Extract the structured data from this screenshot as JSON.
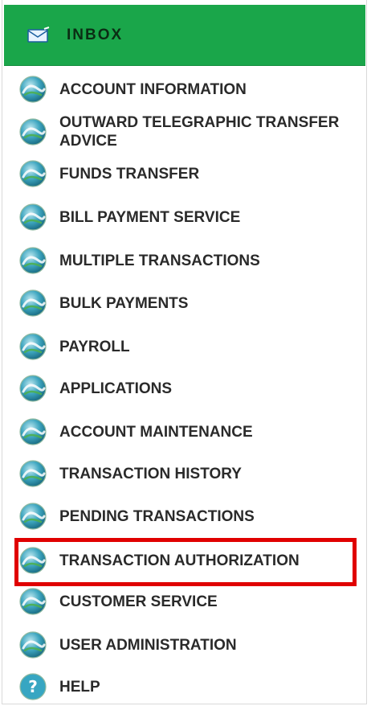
{
  "header": {
    "title": "INBOX",
    "icon": "envelope-icon",
    "background_color": "#1aa64a"
  },
  "menu": {
    "icon": "globe-icon",
    "highlight_color": "#e00000",
    "items": [
      {
        "label": "ACCOUNT INFORMATION"
      },
      {
        "label": "OUTWARD TELEGRAPHIC TRANSFER ADVICE"
      },
      {
        "label": "FUNDS TRANSFER"
      },
      {
        "label": "BILL PAYMENT SERVICE"
      },
      {
        "label": "MULTIPLE TRANSACTIONS"
      },
      {
        "label": "BULK PAYMENTS"
      },
      {
        "label": "PAYROLL"
      },
      {
        "label": "APPLICATIONS"
      },
      {
        "label": "ACCOUNT MAINTENANCE"
      },
      {
        "label": "TRANSACTION HISTORY"
      },
      {
        "label": "PENDING TRANSACTIONS"
      },
      {
        "label": "TRANSACTION AUTHORIZATION",
        "highlighted": true
      },
      {
        "label": "CUSTOMER SERVICE"
      },
      {
        "label": "USER ADMINISTRATION"
      },
      {
        "label": "HELP",
        "icon": "help-icon"
      }
    ]
  }
}
